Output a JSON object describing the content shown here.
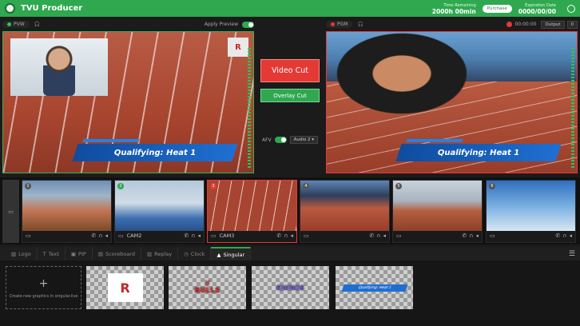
{
  "header": {
    "title": "TVU Producer",
    "time_label": "Time Remaining",
    "time_value": "2000h 00min",
    "purchase_label": "Purchase",
    "exp_label": "Expiration Date",
    "exp_value": "0000/00/00"
  },
  "preview": {
    "tag": "PVW",
    "apply_label": "Apply Preview",
    "lower_third": "Qualifying: Heat 1",
    "bug": "R"
  },
  "program": {
    "tag": "PGM",
    "timer": "00:00:00",
    "output_label": "Output",
    "output_count": "0",
    "lower_third": "Qualifying: Heat 1"
  },
  "controls": {
    "video_cut": "Video Cut",
    "overlay_cut": "Overlay Cut",
    "afv_label": "AFV",
    "audio_select": "Audio 2"
  },
  "cameras": [
    {
      "num": "1",
      "label": ""
    },
    {
      "num": "2",
      "label": "CAM2"
    },
    {
      "num": "3",
      "label": "CAM3"
    },
    {
      "num": "4",
      "label": ""
    },
    {
      "num": "5",
      "label": ""
    },
    {
      "num": "6",
      "label": ""
    }
  ],
  "tabs": [
    {
      "label": "Logo",
      "icon": "image-icon"
    },
    {
      "label": "Text",
      "icon": "text-icon"
    },
    {
      "label": "PIP",
      "icon": "pip-icon"
    },
    {
      "label": "Scoreboard",
      "icon": "scoreboard-icon"
    },
    {
      "label": "Replay",
      "icon": "replay-icon"
    },
    {
      "label": "Clock",
      "icon": "clock-icon"
    },
    {
      "label": "Singular",
      "icon": "singular-icon"
    }
  ],
  "assets": {
    "create_label": "Create new graphics in singular.live",
    "bulls": "BULLS",
    "rhinos": "RHINOS",
    "lower_third": "Qualifying: Heat 1"
  },
  "colors": {
    "brand": "#2fa84f",
    "program": "#e53935",
    "lower_third": "#1f6fd1"
  }
}
